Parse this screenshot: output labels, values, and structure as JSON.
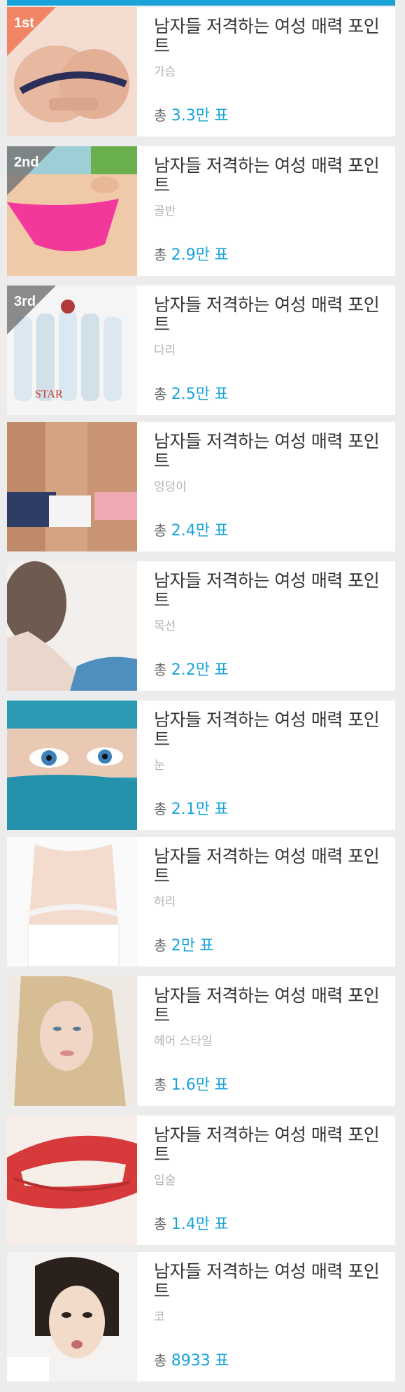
{
  "items": [
    {
      "rank_label": "1st",
      "title": "남자들 저격하는 여성 매력 포인트",
      "subtitle": "가슴",
      "votes_prefix": "총",
      "votes": "3.3만",
      "votes_suffix": "표",
      "thumb_color": "#e8c5b0"
    },
    {
      "rank_label": "2nd",
      "title": "남자들 저격하는 여성 매력 포인트",
      "subtitle": "골반",
      "votes_prefix": "총",
      "votes": "2.9만",
      "votes_suffix": "표",
      "thumb_color": "#f2d1b6"
    },
    {
      "rank_label": "3rd",
      "title": "남자들 저격하는 여성 매력 포인트",
      "subtitle": "다리",
      "votes_prefix": "총",
      "votes": "2.5만",
      "votes_suffix": "표",
      "thumb_color": "#dfe9f0"
    },
    {
      "rank_label": "",
      "title": "남자들 저격하는 여성 매력 포인트",
      "subtitle": "엉덩이",
      "votes_prefix": "총",
      "votes": "2.4만",
      "votes_suffix": "표",
      "thumb_color": "#c89878"
    },
    {
      "rank_label": "",
      "title": "남자들 저격하는 여성 매력 포인트",
      "subtitle": "목선",
      "votes_prefix": "총",
      "votes": "2.2만",
      "votes_suffix": "표",
      "thumb_color": "#e7d8cf"
    },
    {
      "rank_label": "",
      "title": "남자들 저격하는 여성 매력 포인트",
      "subtitle": "눈",
      "votes_prefix": "총",
      "votes": "2.1만",
      "votes_suffix": "표",
      "thumb_color": "#2a9ab5"
    },
    {
      "rank_label": "",
      "title": "남자들 저격하는 여성 매력 포인트",
      "subtitle": "허리",
      "votes_prefix": "총",
      "votes": "2만",
      "votes_suffix": "표",
      "thumb_color": "#f3e4da"
    },
    {
      "rank_label": "",
      "title": "남자들 저격하는 여성 매력 포인트",
      "subtitle": "헤어 스타일",
      "votes_prefix": "총",
      "votes": "1.6만",
      "votes_suffix": "표",
      "thumb_color": "#d9c4a2"
    },
    {
      "rank_label": "",
      "title": "남자들 저격하는 여성 매력 포인트",
      "subtitle": "입술",
      "votes_prefix": "총",
      "votes": "1.4만",
      "votes_suffix": "표",
      "thumb_color": "#d63a3a"
    },
    {
      "rank_label": "",
      "title": "남자들 저격하는 여성 매력 포인트",
      "subtitle": "코",
      "votes_prefix": "총",
      "votes": "8933",
      "votes_suffix": "표",
      "thumb_color": "#3a2e2a"
    }
  ],
  "colors": {
    "accent": "#1aa3d9",
    "first_badge": "#f18060",
    "badge": "#787878"
  }
}
